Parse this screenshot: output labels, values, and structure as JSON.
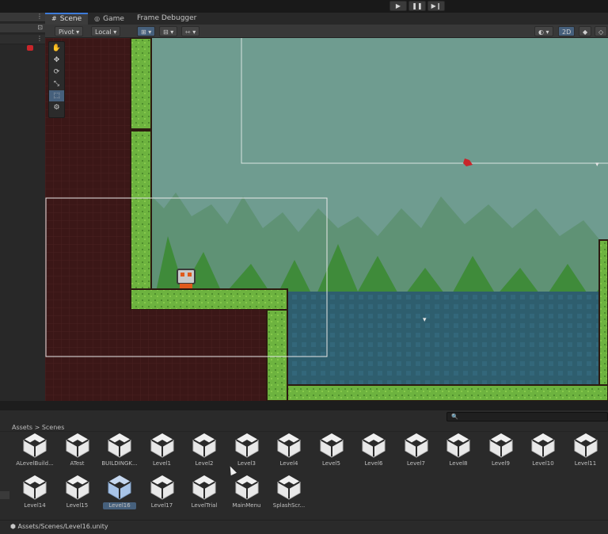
{
  "playmode": {
    "play_label": "▶",
    "pause_label": "❚❚",
    "step_label": "▶❙"
  },
  "left_panel": {
    "menu_icon_1": "⋮",
    "menu_icon_2": "⋮",
    "pin_icon": "⊡"
  },
  "tabs": [
    {
      "label": "Scene",
      "icon": "#"
    },
    {
      "label": "Game",
      "icon": "◎"
    },
    {
      "label": "Frame Debugger",
      "icon": ""
    }
  ],
  "scene_toolbar": {
    "pivot_label": "Pivot ▾",
    "local_label": "Local ▾",
    "grid_label": "⊞ ▾",
    "snap_label": "⊟ ▾",
    "increment_label": "⇿ ▾",
    "shading_label": "◐ ▾",
    "mode_2d_label": "2D",
    "audio_label": "◆",
    "fx_label": "◇"
  },
  "tools": [
    "✋",
    "✥",
    "⟳",
    "⤡",
    "⬚",
    "⚙"
  ],
  "project": {
    "search_placeholder": "🔍",
    "breadcrumb": "Assets  >  Scenes",
    "status_path": "Assets/Scenes/Level16.unity",
    "assets_row1": [
      "ALevelBuild...",
      "ATest",
      "BUILDINGK...",
      "Level1",
      "Level2",
      "Level3",
      "Level4",
      "Level5",
      "Level6",
      "Level7",
      "Level8",
      "Level9",
      "Level10",
      "Level11"
    ],
    "assets_row2": [
      "Level14",
      "Level15",
      "Level16",
      "Level17",
      "LevelTrial",
      "MainMenu",
      "SplashScr..."
    ],
    "selected": "Level16"
  },
  "colors": {
    "accent": "#46607c",
    "tab_accent": "#3d7bd9",
    "sky": "#6f9c90",
    "water": "#2e5e6e",
    "grass": "#6db33f",
    "dirt": "#3b1717"
  }
}
